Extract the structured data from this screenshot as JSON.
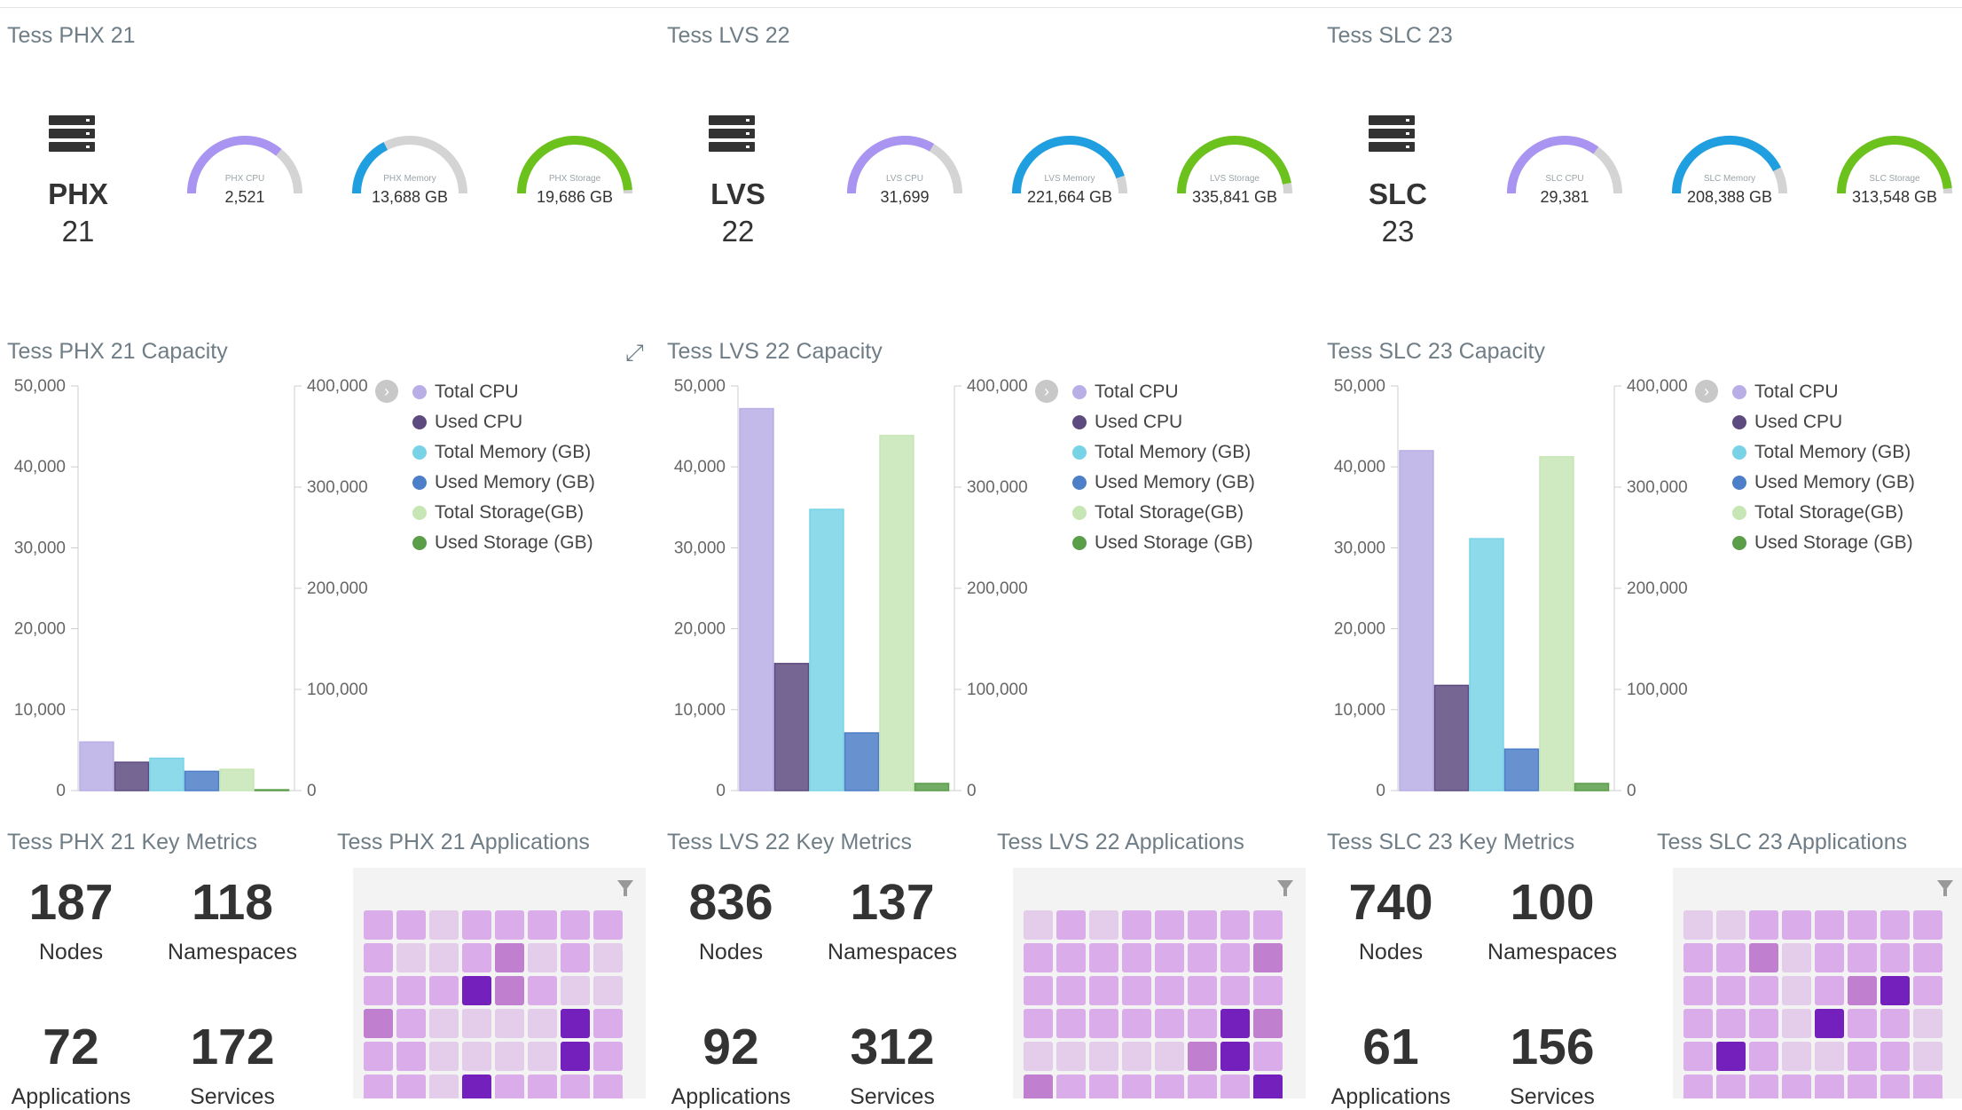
{
  "colors": {
    "cpu_total": "#b9aee6",
    "cpu_used": "#5d4b80",
    "mem_total": "#79d3e7",
    "mem_used": "#4d7ec8",
    "stor_total": "#c7e6b5",
    "stor_used": "#5a9e49",
    "gauge_cpu": "#a994f2",
    "gauge_mem": "#1f9fe0",
    "gauge_stor": "#6cc21c",
    "gauge_track": "#d4d4d4"
  },
  "legend": [
    "Total CPU",
    "Used CPU",
    "Total Memory (GB)",
    "Used Memory (GB)",
    "Total Storage(GB)",
    "Used Storage (GB)"
  ],
  "icons": {
    "datacenter": "server-rack-icon",
    "expand": "expand-icon",
    "legend_nav": "chevron-right-icon",
    "filter": "filter-icon"
  },
  "datacenters": [
    {
      "title": "Tess PHX 21",
      "name": "PHX",
      "number": "21",
      "gauges": [
        {
          "label": "PHX CPU",
          "value": "2,521",
          "fill": 0.72
        },
        {
          "label": "PHX Memory",
          "value": "13,688 GB",
          "fill": 0.35
        },
        {
          "label": "PHX Storage",
          "value": "19,686 GB",
          "fill": 0.98
        }
      ],
      "capacity_title": "Tess PHX 21 Capacity",
      "key_metrics_title": "Tess PHX 21 Key Metrics",
      "applications_title": "Tess PHX 21 Applications",
      "metrics": [
        {
          "value": "187",
          "label": "Nodes"
        },
        {
          "value": "118",
          "label": "Namespaces"
        },
        {
          "value": "72",
          "label": "Applications"
        },
        {
          "value": "172",
          "label": "Services"
        }
      ],
      "heatmap": [
        1,
        1,
        0,
        1,
        1,
        1,
        1,
        1,
        1,
        0,
        0,
        1,
        2,
        0,
        1,
        0,
        1,
        1,
        1,
        3,
        2,
        1,
        0,
        0,
        2,
        1,
        0,
        0,
        0,
        0,
        3,
        1,
        1,
        1,
        0,
        0,
        0,
        0,
        3,
        1,
        1,
        1,
        0,
        3,
        1,
        1,
        1,
        1
      ]
    },
    {
      "title": "Tess LVS 22",
      "name": "LVS",
      "number": "22",
      "gauges": [
        {
          "label": "LVS CPU",
          "value": "31,699",
          "fill": 0.67
        },
        {
          "label": "LVS Memory",
          "value": "221,664 GB",
          "fill": 0.9
        },
        {
          "label": "LVS Storage",
          "value": "335,841 GB",
          "fill": 0.94
        }
      ],
      "capacity_title": "Tess LVS 22 Capacity",
      "key_metrics_title": "Tess LVS 22 Key Metrics",
      "applications_title": "Tess LVS 22 Applications",
      "metrics": [
        {
          "value": "836",
          "label": "Nodes"
        },
        {
          "value": "137",
          "label": "Namespaces"
        },
        {
          "value": "92",
          "label": "Applications"
        },
        {
          "value": "312",
          "label": "Services"
        }
      ],
      "heatmap": [
        0,
        1,
        0,
        1,
        1,
        1,
        1,
        1,
        1,
        1,
        1,
        1,
        1,
        1,
        1,
        2,
        1,
        1,
        1,
        1,
        1,
        1,
        1,
        1,
        1,
        1,
        1,
        1,
        1,
        1,
        3,
        2,
        0,
        0,
        0,
        0,
        0,
        2,
        3,
        1,
        2,
        1,
        1,
        1,
        1,
        1,
        1,
        3
      ]
    },
    {
      "title": "Tess SLC 23",
      "name": "SLC",
      "number": "23",
      "gauges": [
        {
          "label": "SLC CPU",
          "value": "29,381",
          "fill": 0.7
        },
        {
          "label": "SLC Memory",
          "value": "208,388 GB",
          "fill": 0.85
        },
        {
          "label": "SLC Storage",
          "value": "313,548 GB",
          "fill": 0.97
        }
      ],
      "capacity_title": "Tess SLC 23 Capacity",
      "key_metrics_title": "Tess SLC 23 Key Metrics",
      "applications_title": "Tess SLC 23 Applications",
      "metrics": [
        {
          "value": "740",
          "label": "Nodes"
        },
        {
          "value": "100",
          "label": "Namespaces"
        },
        {
          "value": "61",
          "label": "Applications"
        },
        {
          "value": "156",
          "label": "Services"
        }
      ],
      "heatmap": [
        0,
        0,
        1,
        1,
        1,
        1,
        1,
        1,
        1,
        1,
        2,
        0,
        1,
        1,
        1,
        1,
        1,
        1,
        1,
        0,
        1,
        2,
        3,
        1,
        1,
        1,
        1,
        0,
        3,
        1,
        1,
        0,
        1,
        3,
        1,
        0,
        0,
        1,
        1,
        0,
        1,
        1,
        1,
        1,
        1,
        1,
        1,
        1
      ]
    }
  ],
  "chart_data": [
    {
      "type": "bar",
      "title": "Tess PHX 21 Capacity",
      "categories": [
        "Total CPU",
        "Used CPU",
        "Total Memory (GB)",
        "Used Memory (GB)",
        "Total Storage(GB)",
        "Used Storage (GB)"
      ],
      "cpu_values": [
        6000,
        3500
      ],
      "memory_storage_values": [
        32000,
        19000,
        21000,
        800
      ],
      "ylim_left": [
        0,
        50000
      ],
      "ylim_right": [
        0,
        400000
      ],
      "yticks_left": [
        "50,000",
        "40,000",
        "30,000",
        "20,000",
        "10,000",
        "0"
      ],
      "yticks_right": [
        "400,000",
        "300,000",
        "200,000",
        "100,000",
        "0"
      ]
    },
    {
      "type": "bar",
      "title": "Tess LVS 22 Capacity",
      "categories": [
        "Total CPU",
        "Used CPU",
        "Total Memory (GB)",
        "Used Memory (GB)",
        "Total Storage(GB)",
        "Used Storage (GB)"
      ],
      "cpu_values": [
        47200,
        15700
      ],
      "memory_storage_values": [
        278000,
        57000,
        351000,
        7000
      ],
      "ylim_left": [
        0,
        50000
      ],
      "ylim_right": [
        0,
        400000
      ],
      "yticks_left": [
        "50,000",
        "40,000",
        "30,000",
        "20,000",
        "10,000",
        "0"
      ],
      "yticks_right": [
        "400,000",
        "300,000",
        "200,000",
        "100,000",
        "0"
      ]
    },
    {
      "type": "bar",
      "title": "Tess SLC 23 Capacity",
      "categories": [
        "Total CPU",
        "Used CPU",
        "Total Memory (GB)",
        "Used Memory (GB)",
        "Total Storage(GB)",
        "Used Storage (GB)"
      ],
      "cpu_values": [
        42000,
        13000
      ],
      "memory_storage_values": [
        249000,
        41000,
        330000,
        7000
      ],
      "ylim_left": [
        0,
        50000
      ],
      "ylim_right": [
        0,
        400000
      ],
      "yticks_left": [
        "50,000",
        "40,000",
        "30,000",
        "20,000",
        "10,000",
        "0"
      ],
      "yticks_right": [
        "400,000",
        "300,000",
        "200,000",
        "100,000",
        "0"
      ]
    }
  ]
}
